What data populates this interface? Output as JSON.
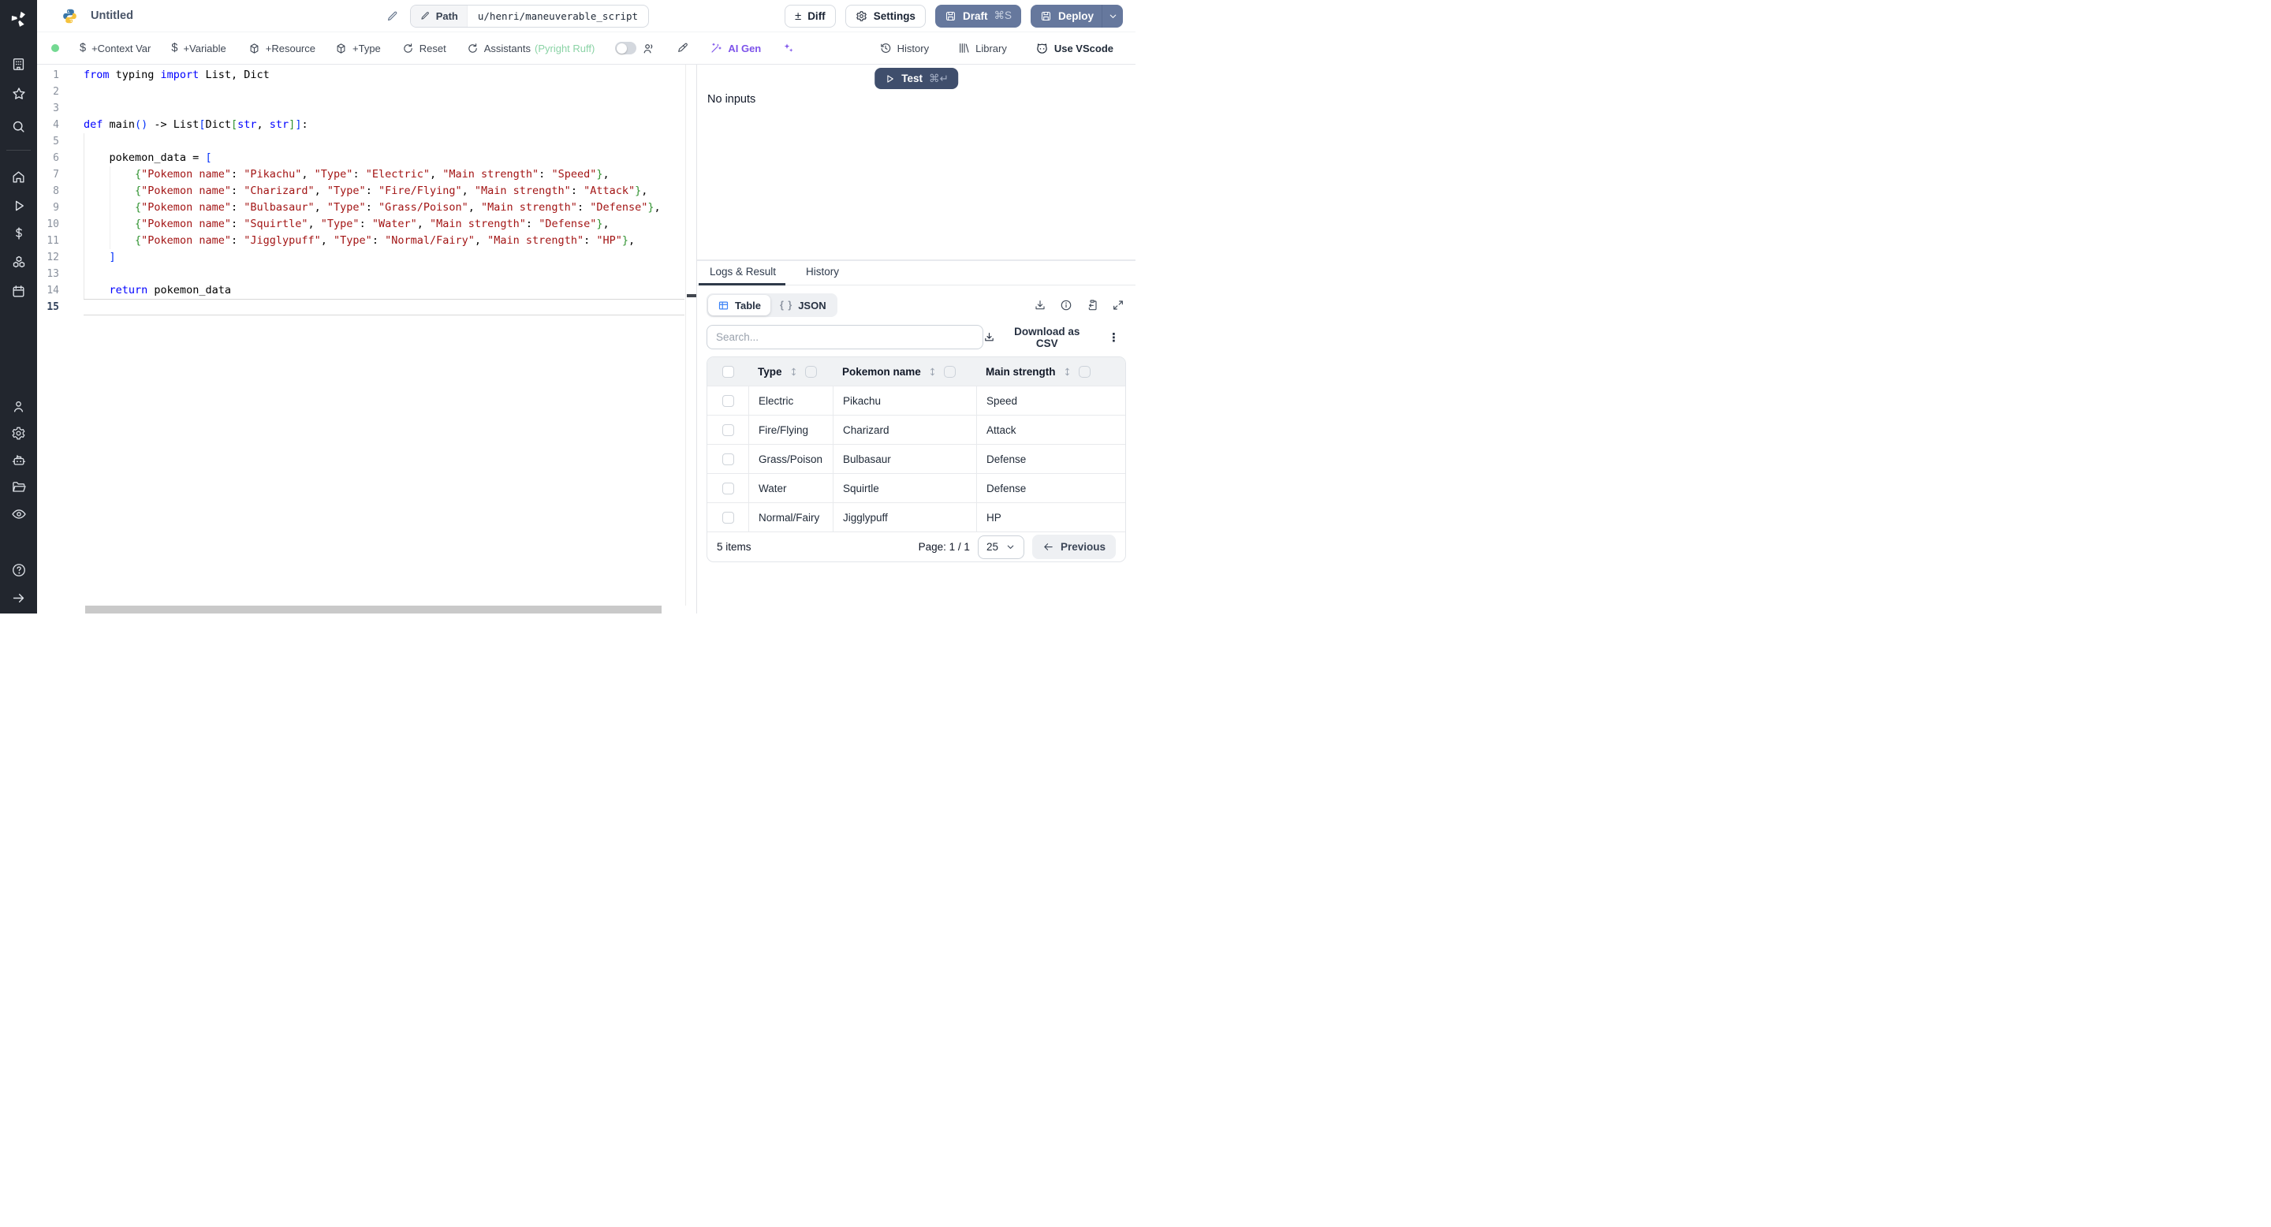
{
  "colors": {
    "sidebar_bg": "#22262e",
    "primary_button": "#66789d",
    "test_button": "#3f4e6c",
    "status_dot_green": "#74d992",
    "assistant_green": "#8bd3a6",
    "ai_purple": "#7d53ea",
    "table_icon_blue": "#3b82f6",
    "code_keyword": "#0000ff",
    "code_string": "#a31515",
    "code_bracket_level1": "#0431fa",
    "code_bracket_level2": "#319331"
  },
  "icons_glyphs": {
    "diff": "±",
    "kebab": "⋮",
    "json_braces": "{ }"
  },
  "sidebar": {
    "items_top": [
      "building",
      "star",
      "search"
    ],
    "items_mid": [
      "home",
      "play",
      "dollar",
      "cubes",
      "calendar"
    ],
    "items_bottom": [
      "user",
      "gear",
      "robot",
      "folder",
      "eye"
    ],
    "items_footer": [
      "help",
      "arrow-right"
    ]
  },
  "topbar": {
    "title": "Untitled",
    "path_label": "Path",
    "path_value": "u/henri/maneuverable_script",
    "diff_label": "Diff",
    "diff_glyph": "±",
    "settings_label": "Settings",
    "draft_label": "Draft",
    "draft_kbd": "⌘S",
    "deploy_label": "Deploy"
  },
  "toolbar": {
    "context_var": "+Context Var",
    "variable": "+Variable",
    "resource": "+Resource",
    "type": "+Type",
    "reset": "Reset",
    "assistants": "Assistants",
    "assistants_detail": "(Pyright Ruff)",
    "ai_gen": "AI Gen",
    "history": "History",
    "library": "Library",
    "vscode": "Use VScode"
  },
  "run": {
    "test_label": "Test",
    "test_kbd": "⌘↵",
    "no_inputs": "No inputs"
  },
  "editor": {
    "cursor_line": 15,
    "lines": [
      {
        "n": 1,
        "tok": [
          [
            "k",
            "from"
          ],
          [
            "t",
            " typing "
          ],
          [
            "k",
            "import"
          ],
          [
            "t",
            " List, Dict"
          ]
        ]
      },
      {
        "n": 2,
        "tok": []
      },
      {
        "n": 3,
        "tok": []
      },
      {
        "n": 4,
        "tok": [
          [
            "k",
            "def"
          ],
          [
            "t",
            " main"
          ],
          [
            "b1",
            "()"
          ],
          [
            "t",
            " -> List"
          ],
          [
            "b1",
            "["
          ],
          [
            "t",
            "Dict"
          ],
          [
            "b2",
            "["
          ],
          [
            "k",
            "str"
          ],
          [
            "t",
            ", "
          ],
          [
            "k",
            "str"
          ],
          [
            "b2",
            "]"
          ],
          [
            "b1",
            "]"
          ],
          [
            "t",
            ":"
          ]
        ]
      },
      {
        "n": 5,
        "tok": []
      },
      {
        "n": 6,
        "tok": [
          [
            "t",
            "    pokemon_data = "
          ],
          [
            "b1",
            "["
          ]
        ]
      },
      {
        "n": 7,
        "tok": [
          [
            "t",
            "        "
          ],
          [
            "b2",
            "{"
          ],
          [
            "s",
            "\"Pokemon name\""
          ],
          [
            "t",
            ": "
          ],
          [
            "s",
            "\"Pikachu\""
          ],
          [
            "t",
            ", "
          ],
          [
            "s",
            "\"Type\""
          ],
          [
            "t",
            ": "
          ],
          [
            "s",
            "\"Electric\""
          ],
          [
            "t",
            ", "
          ],
          [
            "s",
            "\"Main strength\""
          ],
          [
            "t",
            ": "
          ],
          [
            "s",
            "\"Speed\""
          ],
          [
            "b2",
            "}"
          ],
          [
            "t",
            ","
          ]
        ]
      },
      {
        "n": 8,
        "tok": [
          [
            "t",
            "        "
          ],
          [
            "b2",
            "{"
          ],
          [
            "s",
            "\"Pokemon name\""
          ],
          [
            "t",
            ": "
          ],
          [
            "s",
            "\"Charizard\""
          ],
          [
            "t",
            ", "
          ],
          [
            "s",
            "\"Type\""
          ],
          [
            "t",
            ": "
          ],
          [
            "s",
            "\"Fire/Flying\""
          ],
          [
            "t",
            ", "
          ],
          [
            "s",
            "\"Main strength\""
          ],
          [
            "t",
            ": "
          ],
          [
            "s",
            "\"Attack\""
          ],
          [
            "b2",
            "}"
          ],
          [
            "t",
            ","
          ]
        ]
      },
      {
        "n": 9,
        "tok": [
          [
            "t",
            "        "
          ],
          [
            "b2",
            "{"
          ],
          [
            "s",
            "\"Pokemon name\""
          ],
          [
            "t",
            ": "
          ],
          [
            "s",
            "\"Bulbasaur\""
          ],
          [
            "t",
            ", "
          ],
          [
            "s",
            "\"Type\""
          ],
          [
            "t",
            ": "
          ],
          [
            "s",
            "\"Grass/Poison\""
          ],
          [
            "t",
            ", "
          ],
          [
            "s",
            "\"Main strength\""
          ],
          [
            "t",
            ": "
          ],
          [
            "s",
            "\"Defense\""
          ],
          [
            "b2",
            "}"
          ],
          [
            "t",
            ","
          ]
        ]
      },
      {
        "n": 10,
        "tok": [
          [
            "t",
            "        "
          ],
          [
            "b2",
            "{"
          ],
          [
            "s",
            "\"Pokemon name\""
          ],
          [
            "t",
            ": "
          ],
          [
            "s",
            "\"Squirtle\""
          ],
          [
            "t",
            ", "
          ],
          [
            "s",
            "\"Type\""
          ],
          [
            "t",
            ": "
          ],
          [
            "s",
            "\"Water\""
          ],
          [
            "t",
            ", "
          ],
          [
            "s",
            "\"Main strength\""
          ],
          [
            "t",
            ": "
          ],
          [
            "s",
            "\"Defense\""
          ],
          [
            "b2",
            "}"
          ],
          [
            "t",
            ","
          ]
        ]
      },
      {
        "n": 11,
        "tok": [
          [
            "t",
            "        "
          ],
          [
            "b2",
            "{"
          ],
          [
            "s",
            "\"Pokemon name\""
          ],
          [
            "t",
            ": "
          ],
          [
            "s",
            "\"Jigglypuff\""
          ],
          [
            "t",
            ", "
          ],
          [
            "s",
            "\"Type\""
          ],
          [
            "t",
            ": "
          ],
          [
            "s",
            "\"Normal/Fairy\""
          ],
          [
            "t",
            ", "
          ],
          [
            "s",
            "\"Main strength\""
          ],
          [
            "t",
            ": "
          ],
          [
            "s",
            "\"HP\""
          ],
          [
            "b2",
            "}"
          ],
          [
            "t",
            ","
          ]
        ]
      },
      {
        "n": 12,
        "tok": [
          [
            "t",
            "    "
          ],
          [
            "b1",
            "]"
          ]
        ]
      },
      {
        "n": 13,
        "tok": []
      },
      {
        "n": 14,
        "tok": [
          [
            "t",
            "    "
          ],
          [
            "k",
            "return"
          ],
          [
            "t",
            " pokemon_data"
          ]
        ]
      },
      {
        "n": 15,
        "tok": []
      }
    ]
  },
  "result": {
    "tabs": [
      {
        "label": "Logs & Result",
        "active": true
      },
      {
        "label": "History",
        "active": false
      }
    ],
    "view_toggle": [
      {
        "label": "Table",
        "active": true
      },
      {
        "label": "JSON",
        "active": false
      }
    ],
    "search_placeholder": "Search...",
    "download_csv": "Download as CSV",
    "table": {
      "columns": [
        "Type",
        "Pokemon name",
        "Main strength"
      ],
      "rows": [
        [
          "Electric",
          "Pikachu",
          "Speed"
        ],
        [
          "Fire/Flying",
          "Charizard",
          "Attack"
        ],
        [
          "Grass/Poison",
          "Bulbasaur",
          "Defense"
        ],
        [
          "Water",
          "Squirtle",
          "Defense"
        ],
        [
          "Normal/Fairy",
          "Jigglypuff",
          "HP"
        ]
      ]
    },
    "footer": {
      "items": "5 items",
      "page": "Page: 1 / 1",
      "page_size": "25",
      "previous": "Previous"
    }
  }
}
